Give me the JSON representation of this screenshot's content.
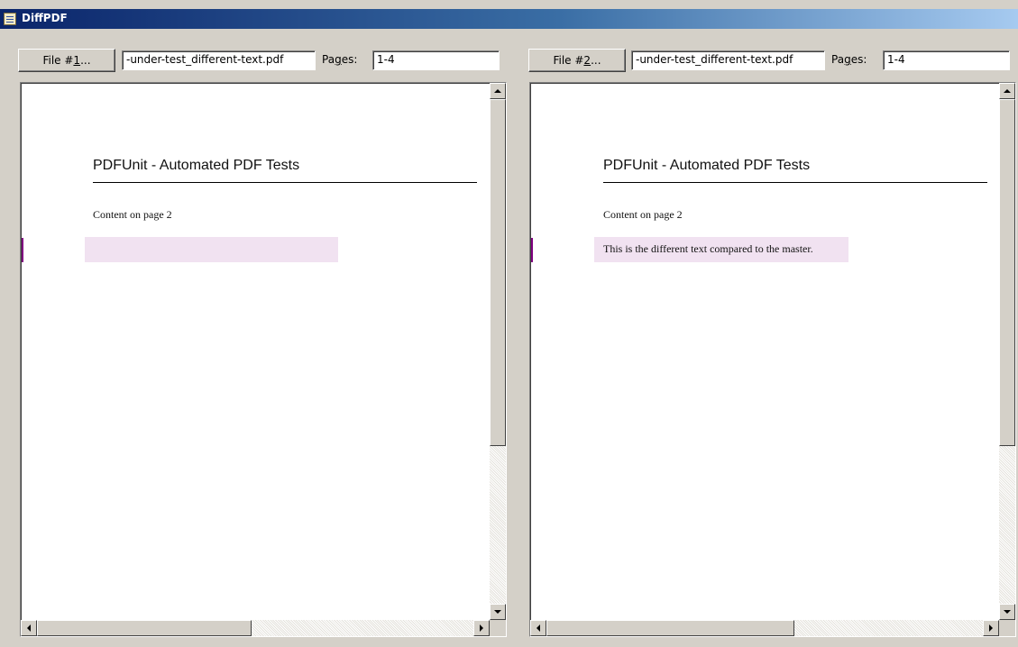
{
  "window": {
    "title": "DiffPDF",
    "icon": "diffpdf-app-icon"
  },
  "left": {
    "file_button": {
      "prefix": "File #",
      "mnemonic": "1",
      "suffix": "..."
    },
    "file_name": "-under-test_different-text.pdf",
    "pages_label": {
      "prefix": "Pa",
      "mnemonic": "g",
      "suffix": "es:"
    },
    "pages_value": "1-4",
    "page": {
      "title": "PDFUnit - Automated PDF Tests",
      "content": "Content on page 2",
      "diff_text": ""
    }
  },
  "right": {
    "file_button": {
      "prefix": "File #",
      "mnemonic": "2",
      "suffix": "..."
    },
    "file_name": "-under-test_different-text.pdf",
    "pages_label": {
      "prefix": "Pa",
      "mnemonic": "g",
      "suffix": "es:"
    },
    "pages_value": "1-4",
    "page": {
      "title": "PDFUnit - Automated PDF Tests",
      "content": "Content on page 2",
      "diff_text": "This is the different text compared to the master."
    }
  },
  "colors": {
    "highlight": "#f1e2f1",
    "marker": "#800080",
    "titlebar": "#0a246a"
  }
}
